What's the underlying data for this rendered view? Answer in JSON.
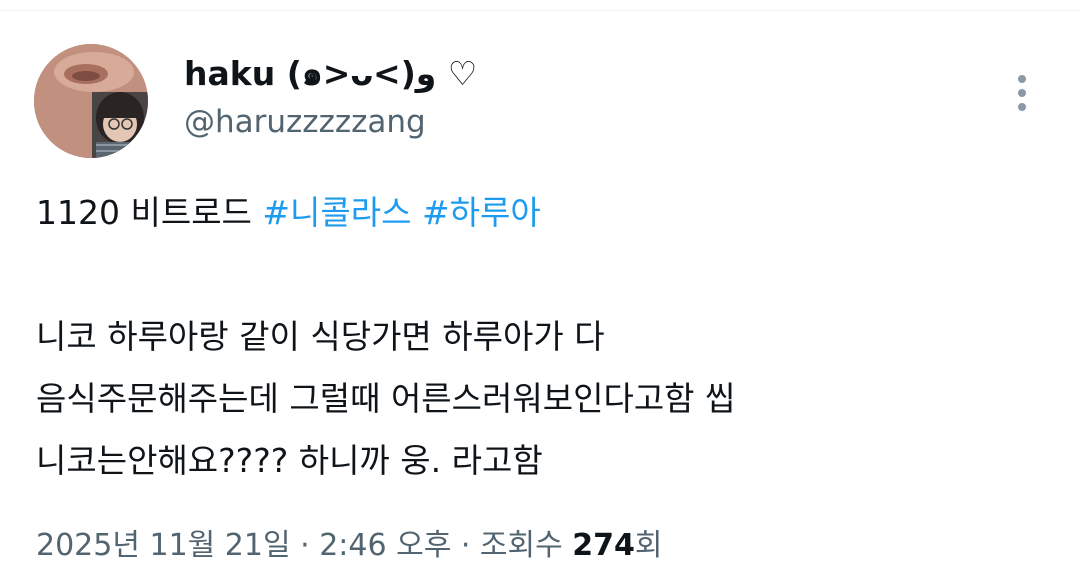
{
  "tweet": {
    "author": {
      "display_name": "haku (๑>ᴗ<)و ♡",
      "handle": "@haruzzzzzang",
      "avatar_icon": "profile-photo"
    },
    "more_icon": "more-vertical-icon",
    "text": {
      "line1_prefix": "1120 비트로드 ",
      "hashtag1": "#니콜라스",
      "hashtag_separator": " ",
      "hashtag2": "#하루아",
      "line2": "니코 하루아랑 같이 식당가면 하루아가 다",
      "line3": "음식주문해주는데 그럴때 어른스러워보인다고함  씹",
      "line4": "니코는안해요???? 하니까 웅. 라고함"
    },
    "meta": {
      "date": "2025년 11월 21일",
      "separator": " · ",
      "time": "2:46 오후",
      "views_label_prefix": "조회수 ",
      "views_count": "274",
      "views_label_suffix": "회"
    },
    "colors": {
      "hashtag": "#1d9bf0",
      "primary_text": "#0f1419",
      "secondary_text": "#536471",
      "more_icon": "#8b98a5"
    }
  }
}
